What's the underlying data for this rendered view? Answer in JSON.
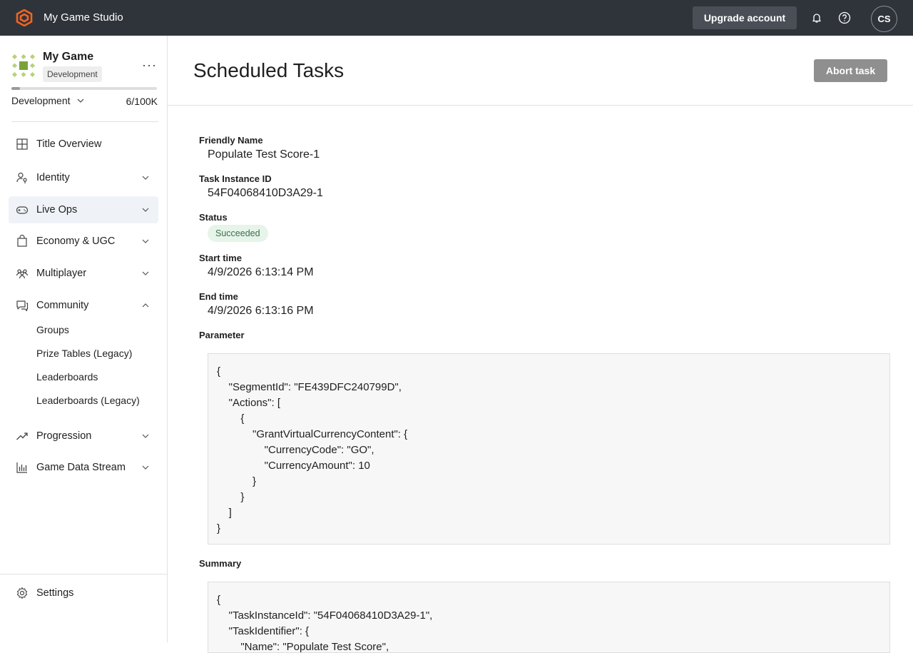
{
  "topbar": {
    "studio_name": "My Game Studio",
    "upgrade_label": "Upgrade account",
    "avatar_initials": "CS",
    "accent_color": "#f26522"
  },
  "sidebar": {
    "game_name": "My Game",
    "env_chip": "Development",
    "env_select": "Development",
    "usage": "6/100K",
    "usage_fraction": 0.06,
    "nav": [
      {
        "label": "Title Overview",
        "icon": "grid-icon"
      },
      {
        "label": "Identity",
        "icon": "user-key-icon"
      },
      {
        "label": "Live Ops",
        "icon": "gamepad-icon"
      },
      {
        "label": "Economy & UGC",
        "icon": "shopping-bag-icon"
      },
      {
        "label": "Multiplayer",
        "icon": "people-icon"
      },
      {
        "label": "Community",
        "icon": "chat-icon"
      },
      {
        "label": "Progression",
        "icon": "trend-icon"
      },
      {
        "label": "Game Data Stream",
        "icon": "bar-chart-icon"
      }
    ],
    "community_sub": [
      "Groups",
      "Prize Tables (Legacy)",
      "Leaderboards",
      "Leaderboards (Legacy)"
    ],
    "settings_label": "Settings"
  },
  "main": {
    "title": "Scheduled Tasks",
    "abort_label": "Abort task",
    "fields": {
      "friendly_name_label": "Friendly Name",
      "friendly_name": "Populate Test Score-1",
      "task_instance_label": "Task Instance ID",
      "task_instance_id": "54F04068410D3A29-1",
      "status_label": "Status",
      "status": "Succeeded",
      "start_label": "Start time",
      "start_time": "4/9/2026 6:13:14 PM",
      "end_label": "End time",
      "end_time": "4/9/2026 6:13:16 PM",
      "parameter_label": "Parameter",
      "parameter_json": "{\n    \"SegmentId\": \"FE439DFC240799D\",\n    \"Actions\": [\n        {\n            \"GrantVirtualCurrencyContent\": {\n                \"CurrencyCode\": \"GO\",\n                \"CurrencyAmount\": 10\n            }\n        }\n    ]\n}",
      "summary_label": "Summary",
      "summary_json": "{\n    \"TaskInstanceId\": \"54F04068410D3A29-1\",\n    \"TaskIdentifier\": {\n        \"Name\": \"Populate Test Score\","
    }
  }
}
